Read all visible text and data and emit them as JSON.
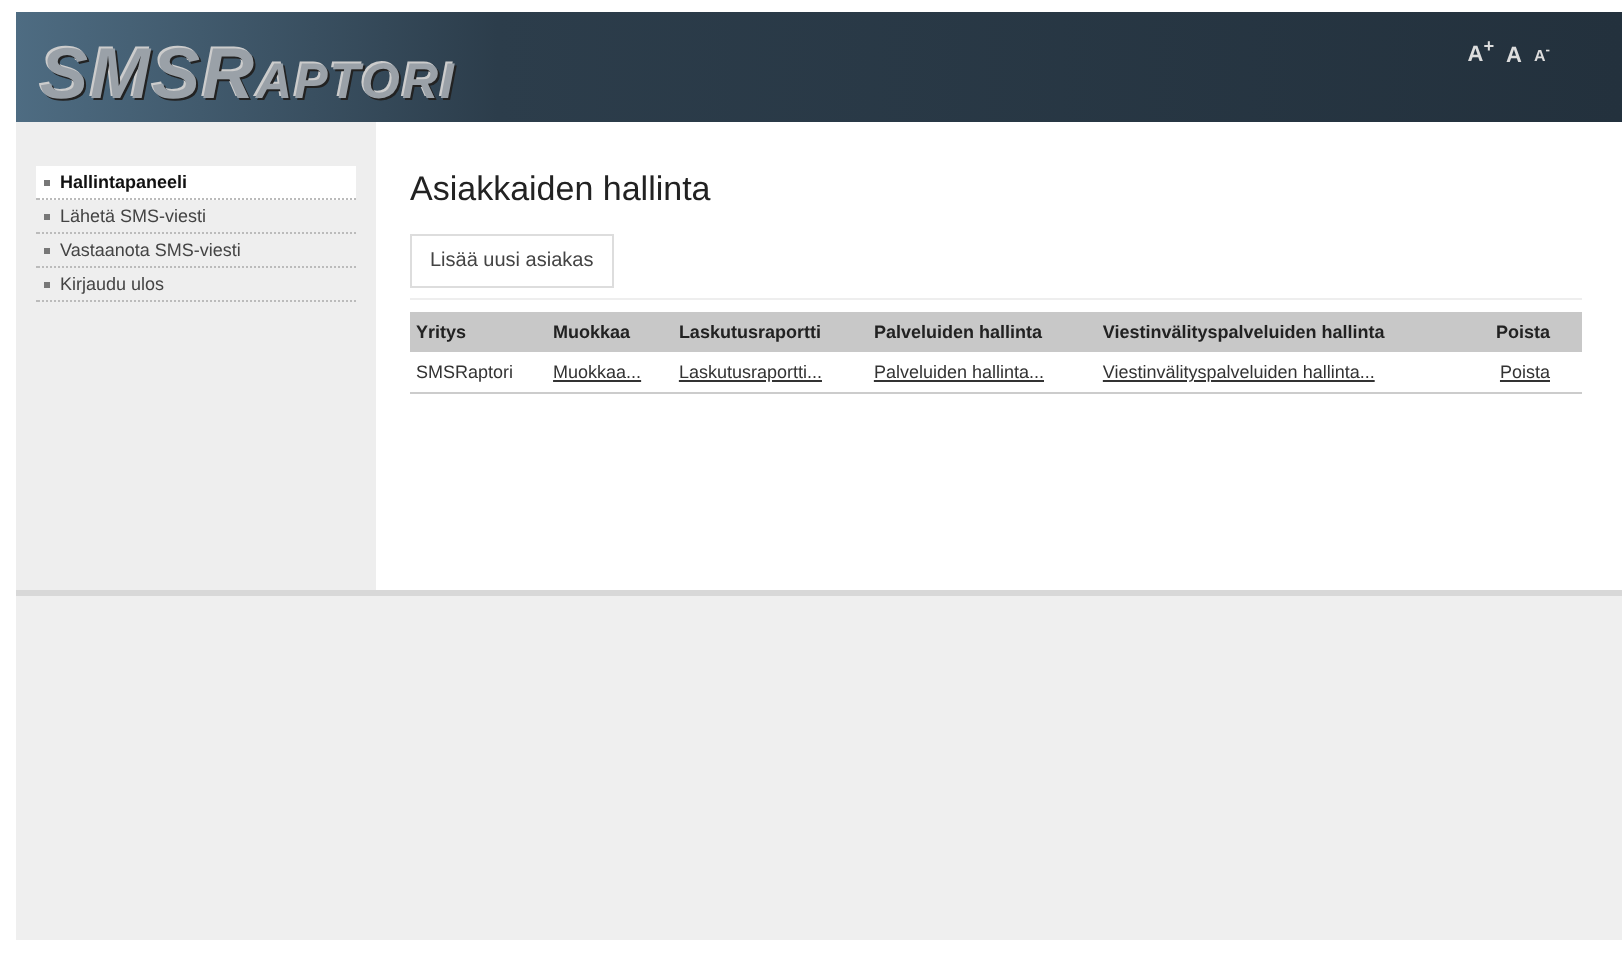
{
  "header": {
    "logo": "SMSRaptori",
    "font_controls": [
      "A$^{+}$",
      "A",
      "A$^{-}$"
    ]
  },
  "sidebar": {
    "items": [
      {
        "label": "Hallintapaneeli",
        "selected": true
      },
      {
        "label": "Lähetä SMS-viesti",
        "selected": false
      },
      {
        "label": "Vastaanota SMS-viesti",
        "selected": false
      },
      {
        "label": "Kirjaudu ulos",
        "selected": false
      }
    ]
  },
  "main": {
    "title": "Asiakkaiden hallinta",
    "add_button": "Lisää uusi asiakas",
    "table": {
      "columns": [
        "Yritys",
        "Muokkaa",
        "Laskutusraportti",
        "Palveluiden hallinta",
        "Viestinvälityspalveluiden hallinta",
        "Poista"
      ],
      "rows": [
        {
          "cells": [
            {
              "text": "SMSRaptori",
              "kind": "text"
            },
            {
              "text": "Muokkaa...",
              "kind": "link"
            },
            {
              "text": "Laskutusraportti...",
              "kind": "link"
            },
            {
              "text": "Palveluiden hallinta...",
              "kind": "link"
            },
            {
              "text": "Viestinvälityspalveluiden hallinta...",
              "kind": "link"
            },
            {
              "text": "Poista",
              "kind": "link"
            }
          ]
        }
      ]
    }
  }
}
